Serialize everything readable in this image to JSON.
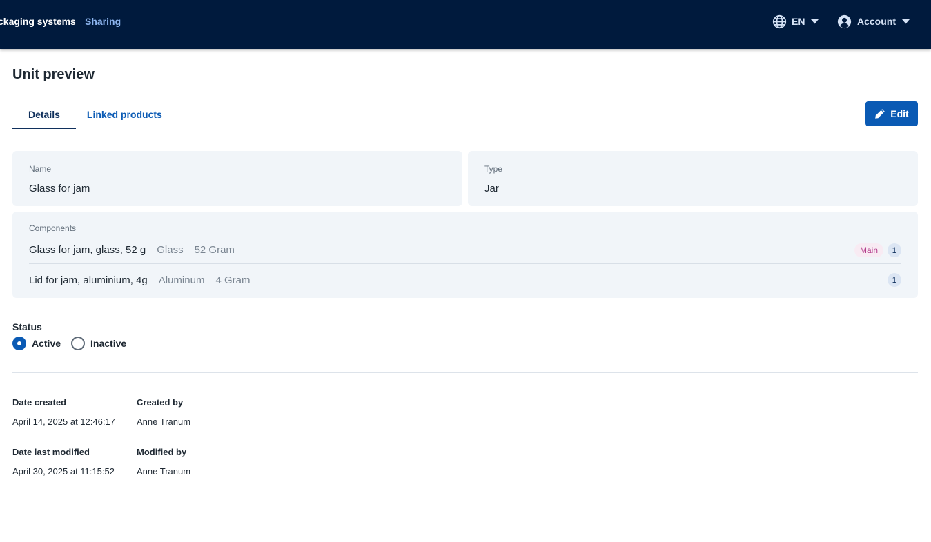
{
  "topbar": {
    "current_section": "ckaging systems",
    "sharing_link": "Sharing",
    "language": "EN",
    "account": "Account"
  },
  "page": {
    "title": "Unit preview",
    "tabs": [
      {
        "label": "Details",
        "active": true
      },
      {
        "label": "Linked products",
        "active": false
      }
    ],
    "edit_label": "Edit"
  },
  "details": {
    "name_label": "Name",
    "name_value": "Glass for jam",
    "type_label": "Type",
    "type_value": "Jar"
  },
  "components": {
    "label": "Components",
    "items": [
      {
        "name": "Glass for jam, glass, 52 g",
        "material": "Glass",
        "weight": "52 Gram",
        "badge": "Main",
        "count": "1"
      },
      {
        "name": "Lid for jam, aluminium, 4g",
        "material": "Aluminum",
        "weight": "4 Gram",
        "count": "1"
      }
    ]
  },
  "status": {
    "label": "Status",
    "options": [
      {
        "label": "Active",
        "checked": true
      },
      {
        "label": "Inactive",
        "checked": false
      }
    ]
  },
  "meta": {
    "date_created_label": "Date created",
    "date_created": "April 14, 2025 at 12:46:17",
    "created_by_label": "Created by",
    "created_by": "Anne Tranum",
    "date_modified_label": "Date last modified",
    "date_modified": "April 30, 2025 at 11:15:52",
    "modified_by_label": "Modified by",
    "modified_by": "Anne Tranum"
  },
  "colors": {
    "topbar": "#001a3d",
    "accent": "#0a5ab4",
    "card": "#f1f5f9",
    "badge_main": "#b43c8c"
  }
}
